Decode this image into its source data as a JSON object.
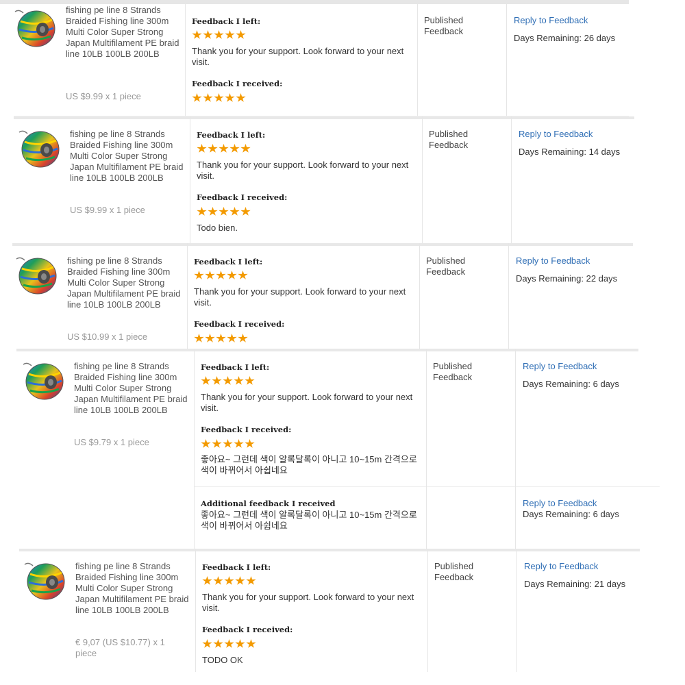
{
  "labels": {
    "feedback_left": "Feedback I left:",
    "feedback_received": "Feedback I received:",
    "additional_received": "Additional feedback I received",
    "status": "Published Feedback",
    "reply": "Reply to Feedback"
  },
  "product_image": "multicolor-fishing-line-spool",
  "orders": [
    {
      "product_title": "fishing pe line 8 Strands Braided Fishing line 300m Multi Color Super Strong Japan Multifilament PE braid line 10LB 100LB 200LB",
      "price": "US $9.99 x 1 piece",
      "left_rating": 5,
      "left_text": "Thank you for your support. Look forward to your next visit.",
      "received_rating": 5,
      "received_text": "",
      "days_remaining": "Days Remaining: 26 days"
    },
    {
      "product_title": "fishing pe line 8 Strands Braided Fishing line 300m Multi Color Super Strong Japan Multifilament PE braid line 10LB 100LB 200LB",
      "price": "US $9.99 x 1 piece",
      "left_rating": 5,
      "left_text": "Thank you for your support. Look forward to your next visit.",
      "received_rating": 5,
      "received_text": "Todo bien.",
      "days_remaining": "Days Remaining: 14 days"
    },
    {
      "product_title": "fishing pe line 8 Strands Braided Fishing line 300m Multi Color Super Strong Japan Multifilament PE braid line 10LB 100LB 200LB",
      "price": "US $10.99 x 1 piece",
      "left_rating": 5,
      "left_text": "Thank you for your support. Look forward to your next visit.",
      "received_rating": 5,
      "received_text": "",
      "days_remaining": "Days Remaining: 22 days"
    },
    {
      "product_title": "fishing pe line 8 Strands Braided Fishing line 300m Multi Color Super Strong Japan Multifilament PE braid line 10LB 100LB 200LB",
      "price": "US $9.79 x 1 piece",
      "left_rating": 5,
      "left_text": "Thank you for your support. Look forward to your next visit.",
      "received_rating": 5,
      "received_text": "좋아요~ 그런데 색이 알록달록이 아니고 10~15m 간격으로 색이 바뀌어서 아쉽네요",
      "days_remaining": "Days Remaining: 6 days",
      "additional_text": "좋아요~ 그런데 색이 알록달록이 아니고 10~15m 간격으로 색이 바뀌어서 아쉽네요",
      "additional_days_remaining": "Days Remaining: 6 days"
    },
    {
      "product_title": "fishing pe line 8 Strands Braided Fishing line 300m Multi Color Super Strong Japan Multifilament PE braid line 10LB 100LB 200LB",
      "price": "€ 9,07 (US $10.77) x 1 piece",
      "left_rating": 5,
      "left_text": "Thank you for your support. Look forward to your next visit.",
      "received_rating": 5,
      "received_text": "TODO OK",
      "days_remaining": "Days Remaining: 21 days"
    }
  ]
}
